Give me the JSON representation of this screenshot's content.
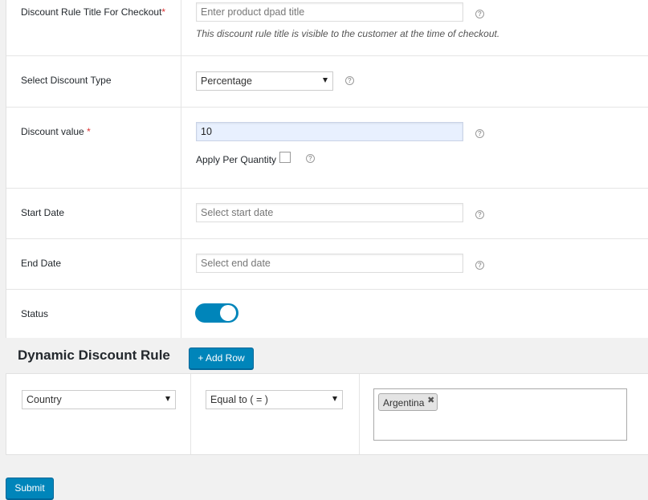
{
  "fields": {
    "title": {
      "label": "Discount Rule Title For Checkout",
      "required_mark": "*",
      "placeholder": "Enter product dpad title",
      "description": "This discount rule title is visible to the customer at the time of checkout."
    },
    "discount_type": {
      "label": "Select Discount Type",
      "selected": "Percentage"
    },
    "discount_value": {
      "label": "Discount value",
      "required_mark": "*",
      "value": "10",
      "apply_per_quantity_label": "Apply Per Quantity",
      "apply_per_quantity_checked": false
    },
    "start_date": {
      "label": "Start Date",
      "placeholder": "Select start date"
    },
    "end_date": {
      "label": "End Date",
      "placeholder": "Select end date"
    },
    "status": {
      "label": "Status",
      "enabled": true
    }
  },
  "help_glyph": "?",
  "dynamic_rule": {
    "title": "Dynamic Discount Rule",
    "add_row_label": "+ Add Row",
    "condition_field": "Country",
    "operator": "Equal to ( = )",
    "values": [
      {
        "label": "Argentina",
        "remove_glyph": "✖"
      }
    ]
  },
  "submit_label": "Submit",
  "colors": {
    "primary": "#0085ba",
    "required": "#dc3232"
  }
}
